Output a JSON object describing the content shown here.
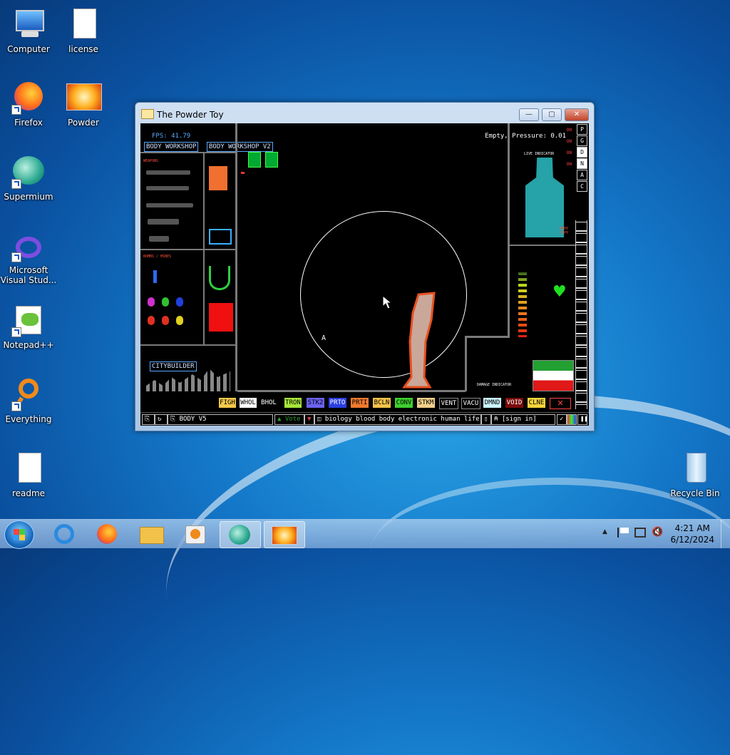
{
  "desktop": {
    "icons": [
      {
        "label": "Computer"
      },
      {
        "label": "license"
      },
      {
        "label": "Firefox"
      },
      {
        "label": "Powder"
      },
      {
        "label": "Supermium"
      },
      {
        "label": "Microsoft Visual Stud..."
      },
      {
        "label": "Notepad++"
      },
      {
        "label": "Everything"
      },
      {
        "label": "readme"
      },
      {
        "label": "Recycle Bin"
      }
    ]
  },
  "window": {
    "title": "The Powder Toy",
    "controls": {
      "minimize": "—",
      "maximize": "▢",
      "close": "✕"
    }
  },
  "game": {
    "fps": "FPS: 41.79",
    "status": "Empty, Pressure: 0.01",
    "tags": [
      "BODY WORKSHOP",
      "BODY WORKSHOP V2"
    ],
    "weapons_label": "WEAPONS",
    "bombs_label": "BOMBS / MINES",
    "live_indicator": "LIVE INDICATOR",
    "body_copy": "BODY COPY",
    "damage_indicator": "DAMAGE INDICATOR",
    "citybuilder": "CITYBUILDER",
    "on_labels": [
      "ON",
      "ON",
      "ON",
      "ON"
    ],
    "right_buttons": [
      "P",
      "G",
      "D",
      "N",
      "A",
      "C"
    ],
    "elements": [
      {
        "label": "FIGH",
        "color": "#f2c84b"
      },
      {
        "label": "WHOL",
        "color": "#ffffff"
      },
      {
        "label": "BHOL",
        "color": "#000000"
      },
      {
        "label": "TRON",
        "color": "#a6e53a"
      },
      {
        "label": "STK2",
        "color": "#6b62f0"
      },
      {
        "label": "PRTO",
        "color": "#2b3fe0"
      },
      {
        "label": "PRTI",
        "color": "#f07a30"
      },
      {
        "label": "BCLN",
        "color": "#f3c24a"
      },
      {
        "label": "CONV",
        "color": "#3fd02f"
      },
      {
        "label": "STKM",
        "color": "#f2d08a"
      },
      {
        "label": "VENT",
        "color": "#000000"
      },
      {
        "label": "VACU",
        "color": "#000000"
      },
      {
        "label": "DMND",
        "color": "#ccf5ff"
      },
      {
        "label": "VOID",
        "color": "#7a0a0a"
      },
      {
        "label": "CLNE",
        "color": "#f3d23a"
      }
    ],
    "bottom": {
      "save_name": "BODY V5",
      "vote": "Vote",
      "tags": "biology blood body electronic human life...",
      "sign_in": "[sign in]"
    },
    "colors": {
      "accent": "#5aa8ff",
      "bar_border": "#7a7a7a",
      "teal_body": "#25a3a8"
    }
  },
  "taskbar": {
    "time": "4:21 AM",
    "date": "6/12/2024"
  }
}
